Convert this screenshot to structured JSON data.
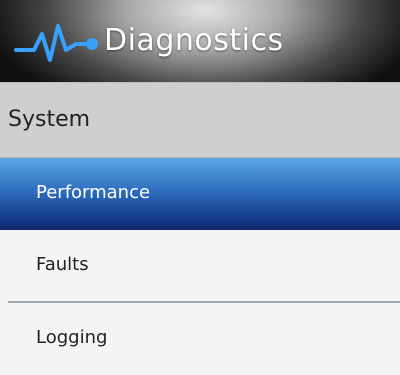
{
  "app": {
    "title": "Diagnostics",
    "logo_icon": "heartbeat-pulse-icon",
    "accent_color": "#2f7fd6"
  },
  "section": {
    "label": "System"
  },
  "menu": {
    "items": [
      {
        "label": "Performance",
        "selected": true
      },
      {
        "label": "Faults",
        "selected": false
      },
      {
        "label": "Logging",
        "selected": false
      }
    ]
  }
}
